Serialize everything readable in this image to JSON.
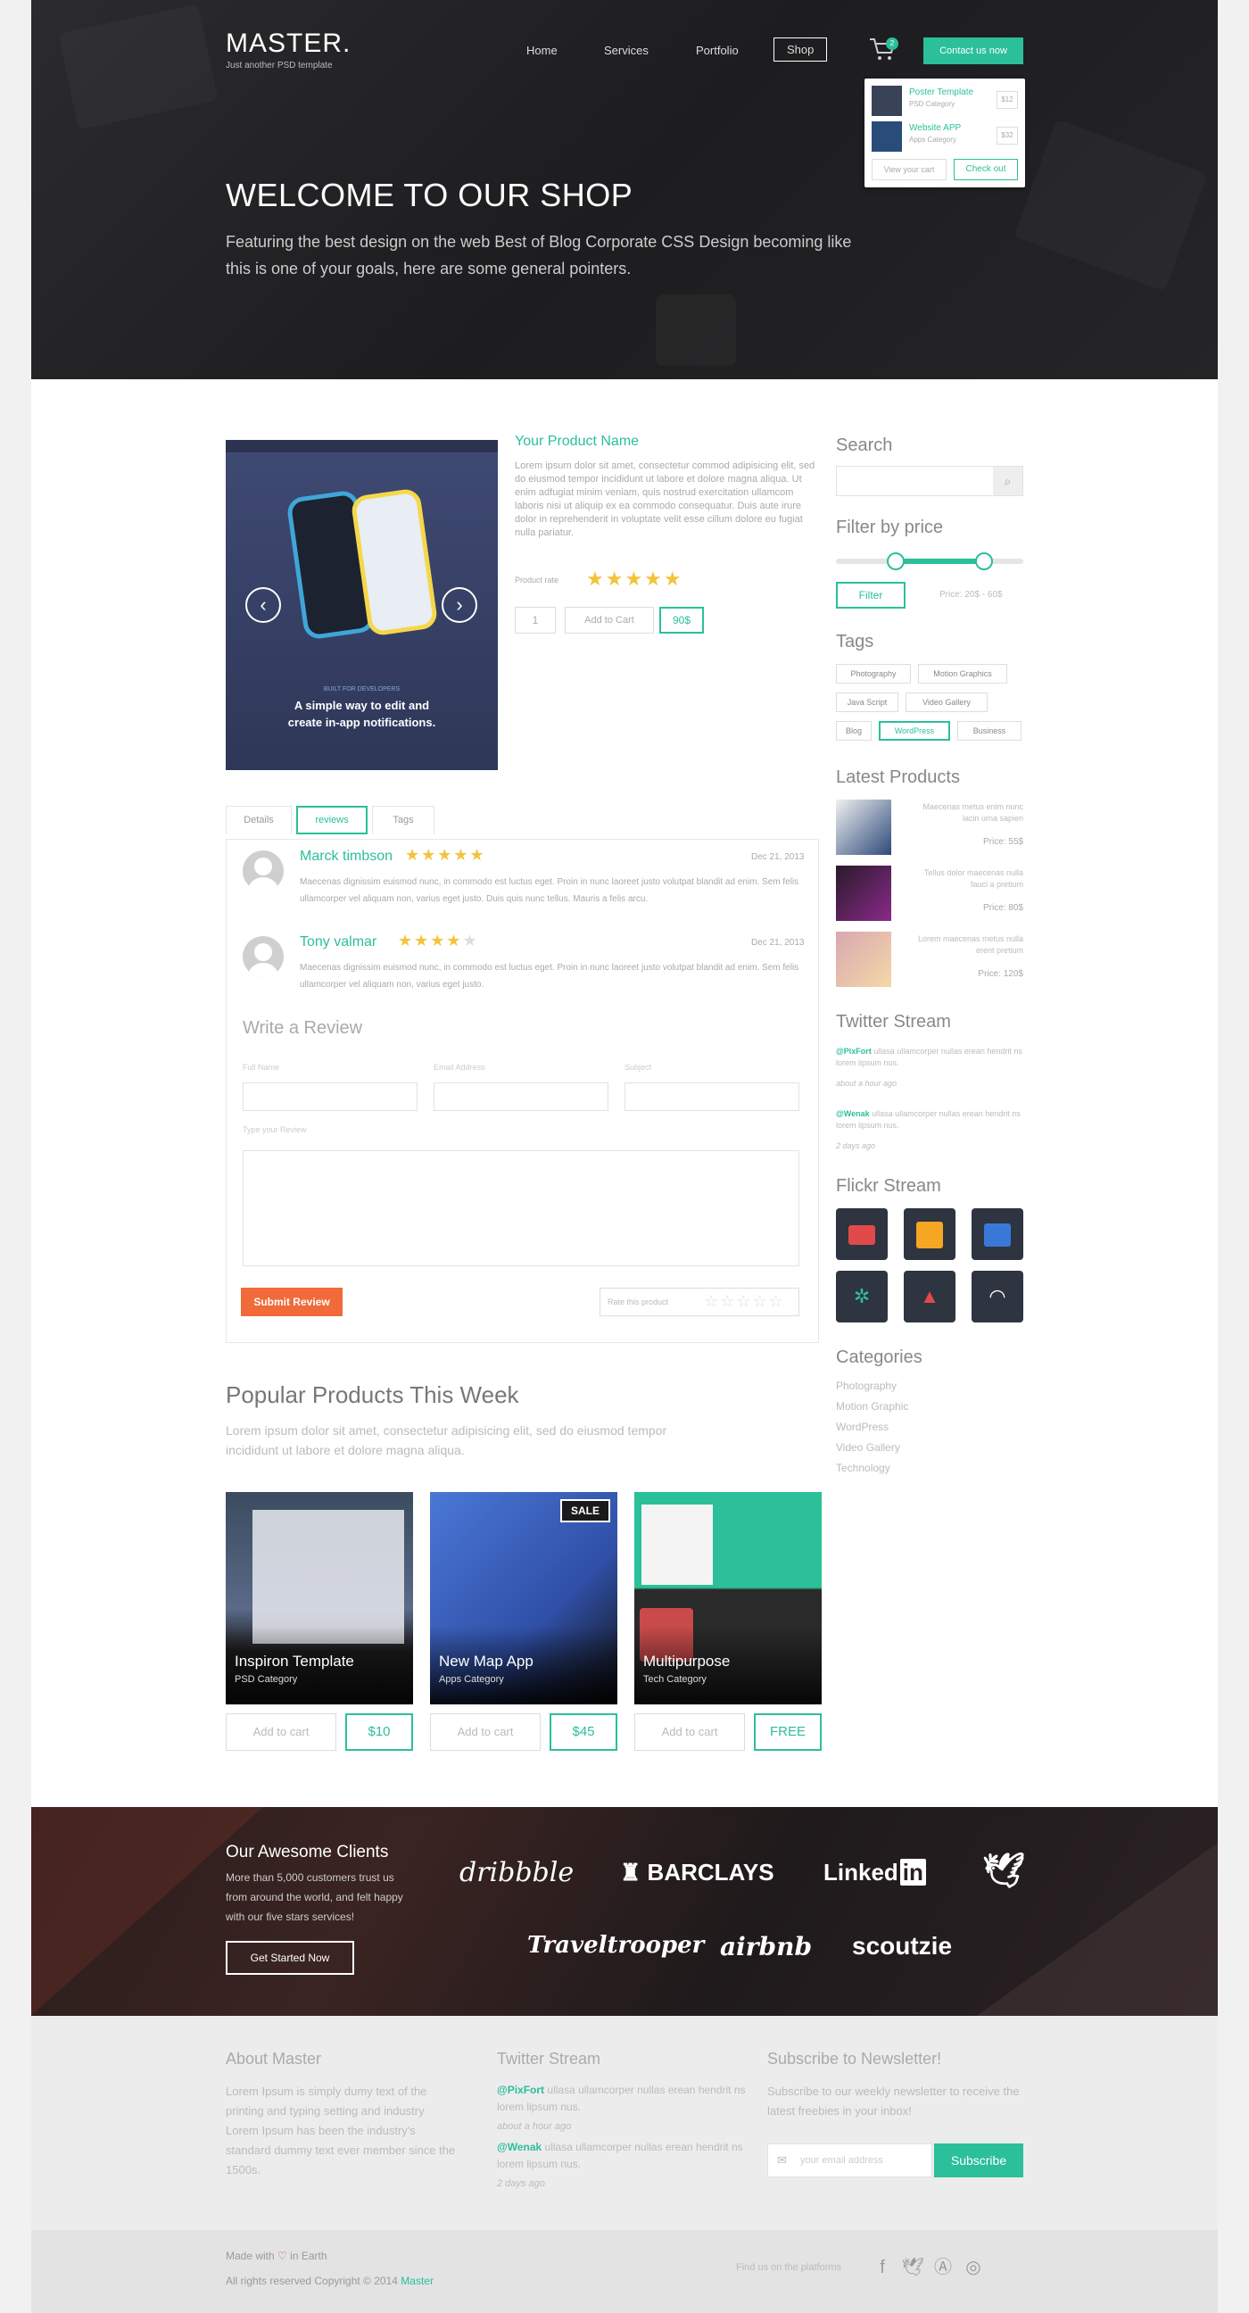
{
  "header": {
    "logo": "MASTER.",
    "tagline": "Just another PSD template",
    "nav": [
      "Home",
      "Services",
      "Portfolio",
      "Shop"
    ],
    "contact_label": "Contact us now",
    "cart_count": "2",
    "cart_items": [
      {
        "name": "Poster Template",
        "category": "PSD Category",
        "price": "$12"
      },
      {
        "name": "Website APP",
        "category": "Apps Category",
        "price": "$32"
      }
    ],
    "view_cart": "View your cart",
    "checkout": "Check out"
  },
  "hero": {
    "title": "WELCOME TO OUR SHOP",
    "subtitle": "Featuring the best design on the web Best of Blog Corporate CSS Design becoming like this is one of your goals, here are some general pointers."
  },
  "product": {
    "image_caption_small": "BUILT FOR DEVELOPERS",
    "image_caption": "A simple way to edit and create in-app notifications.",
    "name": "Your Product Name",
    "description": "Lorem ipsum dolor sit amet, consectetur commod adipisicing elit, sed do eiusmod tempor incididunt ut labore et dolore magna aliqua. Ut enim adfugiat minim veniam, quis nostrud exercitation ullamcom laboris nisi ut aliquip ex ea commodo consequatur. Duis aute irure dolor in reprehenderit in voluptate velit esse cillum dolore eu fugiat nulla pariatur.",
    "rate_label": "Product rate",
    "rating": 5,
    "quantity": "1",
    "add_to_cart": "Add to Cart",
    "price": "90$"
  },
  "tabs": [
    "Details",
    "reviews",
    "Tags"
  ],
  "reviews": [
    {
      "name": "Marck timbson",
      "rating": 5,
      "date": "Dec 21, 2013",
      "text": "Maecenas dignissim euismod nunc, in commodo est luctus eget. Proin in nunc laoreet justo volutpat blandit ad enim. Sem felis ullamcorper vel aliquam non, varius eget justo. Duis quis nunc tellus. Mauris a felis arcu."
    },
    {
      "name": "Tony valmar",
      "rating": 4,
      "date": "Dec 21, 2013",
      "text": "Maecenas dignissim euismod nunc, in commodo est luctus eget. Proin in nunc laoreet justo volutpat blandit ad enim. Sem felis ullamcorper vel aliquam non, varius eget justo."
    }
  ],
  "write_review": {
    "title": "Write a Review",
    "fields": [
      "Full Name",
      "Email Address",
      "Subject"
    ],
    "message_label": "Type your Review",
    "submit": "Submit Review",
    "rate_label": "Rate this product"
  },
  "popular": {
    "title": "Popular Products This Week",
    "subtitle": "Lorem ipsum dolor sit amet, consectetur adipisicing elit, sed do eiusmod tempor incididunt ut labore et dolore magna aliqua.",
    "add_label": "Add to cart",
    "items": [
      {
        "name": "Inspiron Template",
        "category": "PSD Category",
        "price": "$10",
        "badge": ""
      },
      {
        "name": "New Map App",
        "category": "Apps Category",
        "price": "$45",
        "badge": "SALE"
      },
      {
        "name": "Multipurpose",
        "category": "Tech Category",
        "price": "FREE",
        "badge": ""
      }
    ]
  },
  "sidebar": {
    "search_title": "Search",
    "filter_title": "Filter by price",
    "filter_button": "Filter",
    "price_range": "Price: 20$ - 60$",
    "tags_title": "Tags",
    "tags": [
      "Photography",
      "Motion Graphics",
      "Java Script",
      "Video Gallery",
      "Blog",
      "WordPress",
      "Business"
    ],
    "latest_title": "Latest Products",
    "latest": [
      {
        "text": "Maecenas metus enim nunc lacin urna sapien",
        "price": "Price: 55$"
      },
      {
        "text": "Tellus dolor maecenas nulla fauci a pretium",
        "price": "Price: 80$"
      },
      {
        "text": "Lorem maecenas metus nulla erent pretium",
        "price": "Price: 120$"
      }
    ],
    "twitter_title": "Twitter Stream",
    "tweets": [
      {
        "user": "@PixFort",
        "text": "ullasa ullamcorper nullas erean hendrit ns lorem lipsum nus.",
        "time": "about a hour ago"
      },
      {
        "user": "@Wenak",
        "text": "ullasa ullamcorper nullas erean hendrit ns lorem lipsum nus.",
        "time": "2 days ago"
      }
    ],
    "flickr_title": "Flickr Stream",
    "categories_title": "Categories",
    "categories": [
      "Photography",
      "Motion Graphic",
      "WordPress",
      "Video Gallery",
      "Technology"
    ]
  },
  "clients": {
    "title": "Our Awesome Clients",
    "text": "More than 5,000 customers trust us from around the world, and felt happy with our five stars services!",
    "button": "Get Started Now",
    "logos": [
      "dribbble",
      "BARCLAYS",
      "Linked",
      "in",
      "Traveltrooper",
      "airbnb",
      "scoutzie"
    ]
  },
  "footer": {
    "about_title": "About Master",
    "about_text": "Lorem Ipsum is simply dumy text of the printing and typing setting and industry Lorem Ipsum has been the industry's standard dummy text ever member since the 1500s.",
    "twitter_title": "Twitter Stream",
    "tweets": [
      {
        "user": "@PixFort",
        "text": "ullasa ullamcorper nullas erean hendrit ns lorem lipsum nus.",
        "time": "about a hour ago"
      },
      {
        "user": "@Wenak",
        "text": "ullasa ullamcorper nullas erean hendrit ns lorem lipsum nus.",
        "time": "2 days ago"
      }
    ],
    "newsletter_title": "Subscribe to Newsletter!",
    "newsletter_text": "Subscribe to our weekly newsletter to receive the latest freebies in your inbox!",
    "email_placeholder": "your email address",
    "subscribe": "Subscribe",
    "made_with": "Made with",
    "in_earth": "in Earth",
    "copyright": "All rights reserved Copyright © 2014",
    "brand": "Master",
    "find_us": "Find us on the platforms"
  },
  "colors": {
    "accent": "#2bbf9a",
    "submit": "#f06a3a",
    "star": "#f3c33c"
  }
}
